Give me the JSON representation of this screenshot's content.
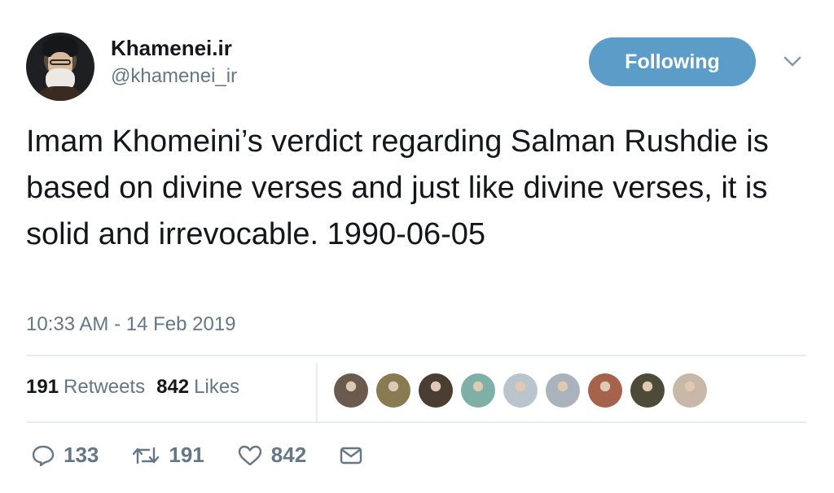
{
  "user": {
    "display_name": "Khamenei.ir",
    "handle": "@khamenei_ir"
  },
  "follow_button": {
    "label": "Following"
  },
  "tweet": {
    "text": "Imam Khomeini’s verdict regarding Salman Rushdie is based on divine verses and just like divine verses, it is solid and irrevocable. 1990-06-05",
    "timestamp": "10:33 AM - 14 Feb 2019"
  },
  "stats": {
    "retweets_count": "191",
    "retweets_label": "Retweets",
    "likes_count": "842",
    "likes_label": "Likes"
  },
  "likers": [
    {
      "color": "#6b5a4e"
    },
    {
      "color": "#8a7a52"
    },
    {
      "color": "#4a3e32"
    },
    {
      "color": "#7fb0a8"
    },
    {
      "color": "#b9c4cc"
    },
    {
      "color": "#aab3bb"
    },
    {
      "color": "#a4634a"
    },
    {
      "color": "#4e4a38"
    },
    {
      "color": "#c9b7a8"
    }
  ],
  "actions": {
    "reply_count": "133",
    "retweet_count": "191",
    "like_count": "842"
  },
  "colors": {
    "accent": "#5b9cc9",
    "secondary_text": "#657786",
    "divider": "#e6ecf0"
  }
}
